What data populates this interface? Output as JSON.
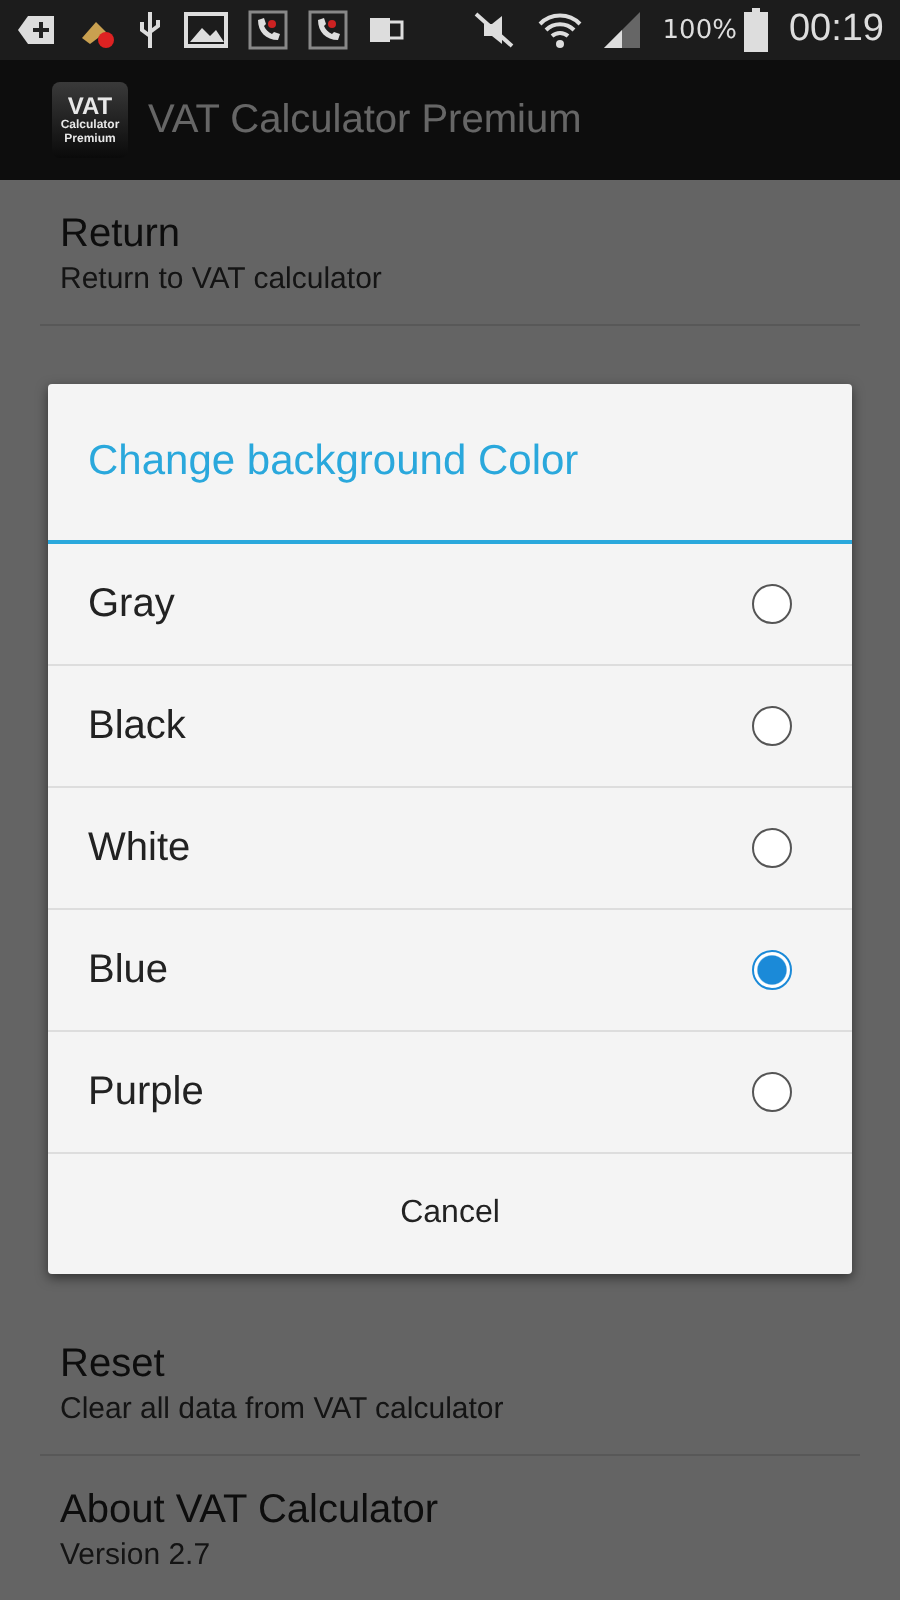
{
  "status_bar": {
    "battery": "100%",
    "time": "00:19"
  },
  "action_bar": {
    "icon_lines": [
      "VAT",
      "Calculator",
      "Premium"
    ],
    "title": "VAT Calculator Premium"
  },
  "list_top": [
    {
      "title": "Return",
      "subtitle": "Return to VAT calculator"
    }
  ],
  "list_bottom": [
    {
      "title": "Reset",
      "subtitle": "Clear all data from VAT calculator"
    },
    {
      "title": "About VAT Calculator",
      "subtitle": "Version 2.7"
    }
  ],
  "dialog": {
    "title": "Change background Color",
    "options": [
      {
        "label": "Gray",
        "selected": false
      },
      {
        "label": "Black",
        "selected": false
      },
      {
        "label": "White",
        "selected": false
      },
      {
        "label": "Blue",
        "selected": true
      },
      {
        "label": "Purple",
        "selected": false
      }
    ],
    "cancel": "Cancel"
  }
}
